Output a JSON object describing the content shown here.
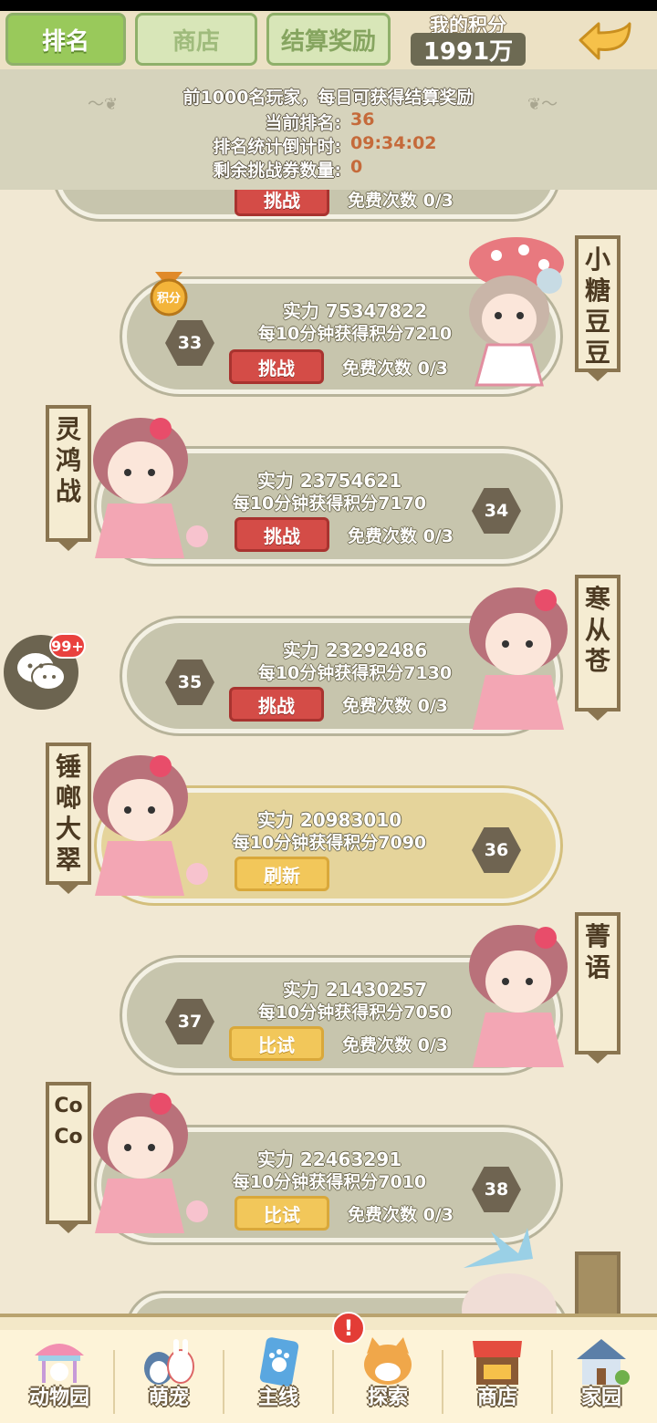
{
  "tabs": [
    {
      "label": "排名",
      "active": true
    },
    {
      "label": "商店",
      "active": false
    },
    {
      "label": "结算奖励",
      "active": false
    }
  ],
  "score": {
    "label": "我的积分",
    "value": "1991万"
  },
  "info": {
    "headline": "前1000名玩家，每日可获得结算奖励",
    "rank_label": "当前排名:",
    "rank_value": "36",
    "countdown_label": "排名统计倒计时:",
    "countdown_value": "09:34:02",
    "tickets_label": "剩余挑战券数量:",
    "tickets_value": "0"
  },
  "partial_top": {
    "button": "挑战",
    "free": "免费次数 0/3"
  },
  "badge": {
    "label": "积分"
  },
  "cards": [
    {
      "rank": "33",
      "power": "实力 75347822",
      "rate": "每10分钟获得积分7210",
      "button": "挑战",
      "button_style": "red",
      "free": "免费次数 0/3",
      "name": [
        "小",
        "糖",
        "豆",
        "豆"
      ]
    },
    {
      "rank": "34",
      "power": "实力 23754621",
      "rate": "每10分钟获得积分7170",
      "button": "挑战",
      "button_style": "red",
      "free": "免费次数 0/3",
      "name": [
        "灵",
        "鸿",
        "战"
      ]
    },
    {
      "rank": "35",
      "power": "实力 23292486",
      "rate": "每10分钟获得积分7130",
      "button": "挑战",
      "button_style": "red",
      "free": "免费次数 0/3",
      "name": [
        "寒",
        "从",
        "苍"
      ]
    },
    {
      "rank": "36",
      "power": "实力 20983010",
      "rate": "每10分钟获得积分7090",
      "button": "刷新",
      "button_style": "yellow",
      "free": "",
      "name": [
        "锤",
        "啷",
        "大",
        "翠"
      ]
    },
    {
      "rank": "37",
      "power": "实力 21430257",
      "rate": "每10分钟获得积分7050",
      "button": "比试",
      "button_style": "yellow",
      "free": "免费次数 0/3",
      "name": [
        "菁",
        "语"
      ]
    },
    {
      "rank": "38",
      "power": "实力 22463291",
      "rate": "每10分钟获得积分7010",
      "button": "比试",
      "button_style": "yellow",
      "free": "免费次数 0/3",
      "name": [
        "Co",
        "Co"
      ]
    }
  ],
  "chat_badge": "99+",
  "nav": [
    {
      "label": "动物园",
      "icon": "carousel-icon"
    },
    {
      "label": "萌宠",
      "icon": "pets-icon"
    },
    {
      "label": "主线",
      "icon": "paw-phone-icon"
    },
    {
      "label": "探索",
      "icon": "cat-explore-icon"
    },
    {
      "label": "商店",
      "icon": "shop-icon"
    },
    {
      "label": "家园",
      "icon": "house-icon"
    }
  ],
  "nav_alert": "!",
  "colors": {
    "accent_green": "#99c95b",
    "challenge_red": "#d44c47",
    "highlight_gold": "#e5d49b",
    "value_orange": "#c56a3a"
  }
}
